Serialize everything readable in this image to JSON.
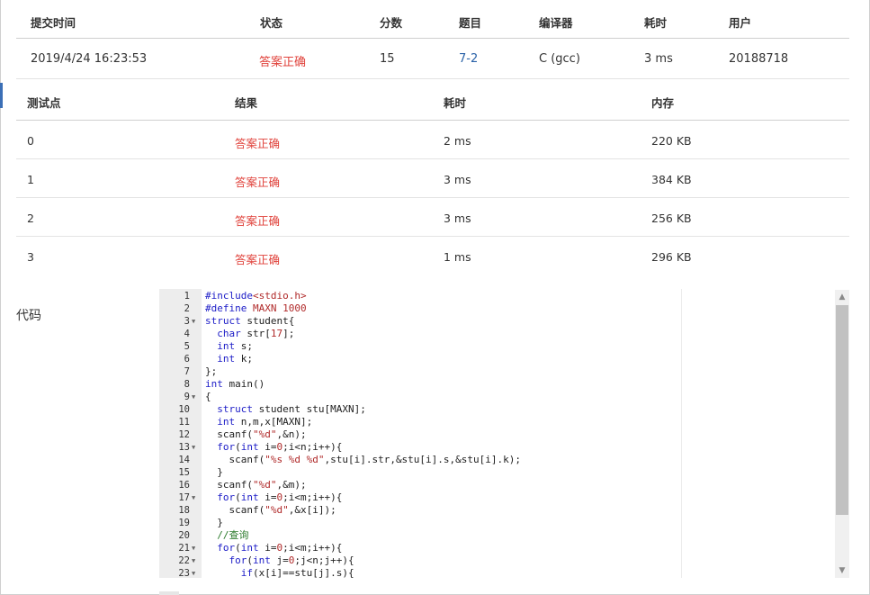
{
  "submission": {
    "headers": [
      "提交时间",
      "状态",
      "分数",
      "题目",
      "编译器",
      "耗时",
      "用户"
    ],
    "row": {
      "time": "2019/4/24 16:23:53",
      "status": "答案正确",
      "score": "15",
      "problem": "7-2",
      "compiler": "C (gcc)",
      "runtime": "3 ms",
      "user": "20188718"
    }
  },
  "tests": {
    "headers": [
      "测试点",
      "结果",
      "耗时",
      "内存"
    ],
    "rows": [
      {
        "id": "0",
        "result": "答案正确",
        "time": "2 ms",
        "memory": "220 KB"
      },
      {
        "id": "1",
        "result": "答案正确",
        "time": "3 ms",
        "memory": "384 KB"
      },
      {
        "id": "2",
        "result": "答案正确",
        "time": "3 ms",
        "memory": "256 KB"
      },
      {
        "id": "3",
        "result": "答案正确",
        "time": "1 ms",
        "memory": "296 KB"
      }
    ]
  },
  "code": {
    "label": "代码",
    "lines": [
      {
        "n": "1",
        "fold": false,
        "tokens": [
          [
            "pre",
            "#include"
          ],
          [
            "str",
            "<stdio.h>"
          ]
        ]
      },
      {
        "n": "2",
        "fold": false,
        "tokens": [
          [
            "pre",
            "#define"
          ],
          [
            "pl",
            " "
          ],
          [
            "str",
            "MAXN 1000"
          ]
        ]
      },
      {
        "n": "3",
        "fold": true,
        "tokens": [
          [
            "kw",
            "struct"
          ],
          [
            "pl",
            " student{"
          ]
        ]
      },
      {
        "n": "4",
        "fold": false,
        "tokens": [
          [
            "pl",
            "  "
          ],
          [
            "kw",
            "char"
          ],
          [
            "pl",
            " str["
          ],
          [
            "str",
            "17"
          ],
          [
            "pl",
            "];"
          ]
        ]
      },
      {
        "n": "5",
        "fold": false,
        "tokens": [
          [
            "pl",
            "  "
          ],
          [
            "kw",
            "int"
          ],
          [
            "pl",
            " s;"
          ]
        ]
      },
      {
        "n": "6",
        "fold": false,
        "tokens": [
          [
            "pl",
            "  "
          ],
          [
            "kw",
            "int"
          ],
          [
            "pl",
            " k;"
          ]
        ]
      },
      {
        "n": "7",
        "fold": false,
        "tokens": [
          [
            "pl",
            "};"
          ]
        ]
      },
      {
        "n": "8",
        "fold": false,
        "tokens": [
          [
            "kw",
            "int"
          ],
          [
            "pl",
            " main()"
          ]
        ]
      },
      {
        "n": "9",
        "fold": true,
        "tokens": [
          [
            "pl",
            "{"
          ]
        ]
      },
      {
        "n": "10",
        "fold": false,
        "tokens": [
          [
            "pl",
            "  "
          ],
          [
            "kw",
            "struct"
          ],
          [
            "pl",
            " student stu[MAXN];"
          ]
        ]
      },
      {
        "n": "11",
        "fold": false,
        "tokens": [
          [
            "pl",
            "  "
          ],
          [
            "kw",
            "int"
          ],
          [
            "pl",
            " n,m,x[MAXN];"
          ]
        ]
      },
      {
        "n": "12",
        "fold": false,
        "tokens": [
          [
            "pl",
            "  scanf("
          ],
          [
            "str",
            "\"%d\""
          ],
          [
            "pl",
            ",&n);"
          ]
        ]
      },
      {
        "n": "13",
        "fold": true,
        "tokens": [
          [
            "pl",
            "  "
          ],
          [
            "kw",
            "for"
          ],
          [
            "pl",
            "("
          ],
          [
            "kw",
            "int"
          ],
          [
            "pl",
            " i="
          ],
          [
            "str",
            "0"
          ],
          [
            "pl",
            ";i<n;i++){"
          ]
        ]
      },
      {
        "n": "14",
        "fold": false,
        "tokens": [
          [
            "pl",
            "    scanf("
          ],
          [
            "str",
            "\"%s %d %d\""
          ],
          [
            "pl",
            ",stu[i].str,&stu[i].s,&stu[i].k);"
          ]
        ]
      },
      {
        "n": "15",
        "fold": false,
        "tokens": [
          [
            "pl",
            "  }"
          ]
        ]
      },
      {
        "n": "16",
        "fold": false,
        "tokens": [
          [
            "pl",
            "  scanf("
          ],
          [
            "str",
            "\"%d\""
          ],
          [
            "pl",
            ",&m);"
          ]
        ]
      },
      {
        "n": "17",
        "fold": true,
        "tokens": [
          [
            "pl",
            "  "
          ],
          [
            "kw",
            "for"
          ],
          [
            "pl",
            "("
          ],
          [
            "kw",
            "int"
          ],
          [
            "pl",
            " i="
          ],
          [
            "str",
            "0"
          ],
          [
            "pl",
            ";i<m;i++){"
          ]
        ]
      },
      {
        "n": "18",
        "fold": false,
        "tokens": [
          [
            "pl",
            "    scanf("
          ],
          [
            "str",
            "\"%d\""
          ],
          [
            "pl",
            ",&x[i]);"
          ]
        ]
      },
      {
        "n": "19",
        "fold": false,
        "tokens": [
          [
            "pl",
            "  }"
          ]
        ]
      },
      {
        "n": "20",
        "fold": false,
        "tokens": [
          [
            "pl",
            "  "
          ],
          [
            "cm",
            "//查询"
          ]
        ]
      },
      {
        "n": "21",
        "fold": true,
        "tokens": [
          [
            "pl",
            "  "
          ],
          [
            "kw",
            "for"
          ],
          [
            "pl",
            "("
          ],
          [
            "kw",
            "int"
          ],
          [
            "pl",
            " i="
          ],
          [
            "str",
            "0"
          ],
          [
            "pl",
            ";i<m;i++){"
          ]
        ]
      },
      {
        "n": "22",
        "fold": true,
        "tokens": [
          [
            "pl",
            "    "
          ],
          [
            "kw",
            "for"
          ],
          [
            "pl",
            "("
          ],
          [
            "kw",
            "int"
          ],
          [
            "pl",
            " j="
          ],
          [
            "str",
            "0"
          ],
          [
            "pl",
            ";j<n;j++){"
          ]
        ]
      },
      {
        "n": "23",
        "fold": true,
        "tokens": [
          [
            "pl",
            "      "
          ],
          [
            "kw",
            "if"
          ],
          [
            "pl",
            "(x[i]==stu[j].s){"
          ]
        ]
      }
    ]
  },
  "icons": {
    "fold": "fold-arrow-icon",
    "scroll_up": "scroll-up-arrow-icon",
    "scroll_down": "scroll-down-arrow-icon"
  },
  "colors": {
    "status_ok": "#e0423b",
    "link": "#2a62a8",
    "keyword": "#2020c8",
    "string": "#b02a2a",
    "comment": "#2a7a2a"
  }
}
